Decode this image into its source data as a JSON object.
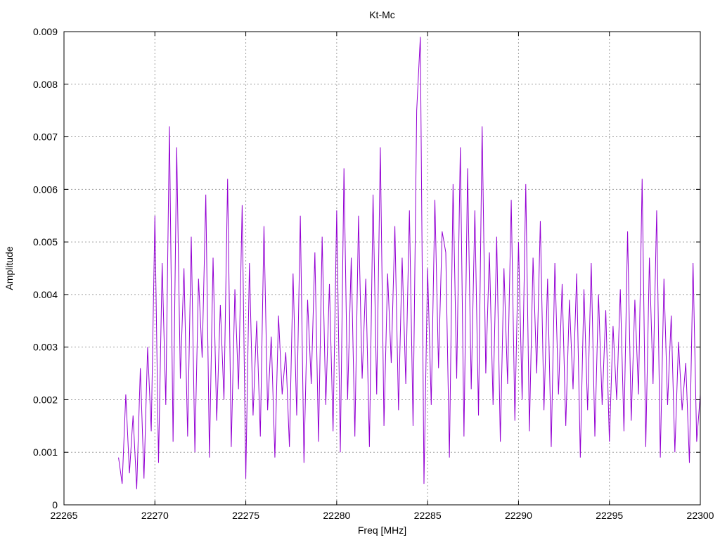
{
  "chart_data": {
    "type": "line",
    "title": "Kt-Mc",
    "xlabel": "Freq [MHz]",
    "ylabel": "Amplitude",
    "xlim": [
      22265,
      22300
    ],
    "ylim": [
      0,
      0.009
    ],
    "grid": true,
    "legend": "none",
    "line_color": "#9400d3",
    "x_ticks": [
      22265,
      22270,
      22275,
      22280,
      22285,
      22290,
      22295,
      22300
    ],
    "x_tick_labels": [
      "22265",
      "22270",
      "22275",
      "22280",
      "22285",
      "22290",
      "22295",
      "22300"
    ],
    "y_ticks": [
      0,
      0.001,
      0.002,
      0.003,
      0.004,
      0.005,
      0.006,
      0.007,
      0.008,
      0.009
    ],
    "y_tick_labels": [
      "0",
      "0.001",
      "0.002",
      "0.003",
      "0.004",
      "0.005",
      "0.006",
      "0.007",
      "0.008",
      "0.009"
    ],
    "series": [
      {
        "x": [
          22268.0,
          22268.2,
          22268.4,
          22268.6,
          22268.8,
          22269.0,
          22269.2,
          22269.4,
          22269.6,
          22269.8,
          22270.0,
          22270.2,
          22270.4,
          22270.6,
          22270.8,
          22271.0,
          22271.2,
          22271.4,
          22271.6,
          22271.8,
          22272.0,
          22272.2,
          22272.4,
          22272.6,
          22272.8,
          22273.0,
          22273.2,
          22273.4,
          22273.6,
          22273.8,
          22274.0,
          22274.2,
          22274.4,
          22274.6,
          22274.8,
          22275.0,
          22275.2,
          22275.4,
          22275.6,
          22275.8,
          22276.0,
          22276.2,
          22276.4,
          22276.6,
          22276.8,
          22277.0,
          22277.2,
          22277.4,
          22277.6,
          22277.8,
          22278.0,
          22278.2,
          22278.4,
          22278.6,
          22278.8,
          22279.0,
          22279.2,
          22279.4,
          22279.6,
          22279.8,
          22280.0,
          22280.2,
          22280.4,
          22280.6,
          22280.8,
          22281.0,
          22281.2,
          22281.4,
          22281.6,
          22281.8,
          22282.0,
          22282.2,
          22282.4,
          22282.6,
          22282.8,
          22283.0,
          22283.2,
          22283.4,
          22283.6,
          22283.8,
          22284.0,
          22284.2,
          22284.4,
          22284.6,
          22284.8,
          22285.0,
          22285.2,
          22285.4,
          22285.6,
          22285.8,
          22286.0,
          22286.2,
          22286.4,
          22286.6,
          22286.8,
          22287.0,
          22287.2,
          22287.4,
          22287.6,
          22287.8,
          22288.0,
          22288.2,
          22288.4,
          22288.6,
          22288.8,
          22289.0,
          22289.2,
          22289.4,
          22289.6,
          22289.8,
          22290.0,
          22290.2,
          22290.4,
          22290.6,
          22290.8,
          22291.0,
          22291.2,
          22291.4,
          22291.6,
          22291.8,
          22292.0,
          22292.2,
          22292.4,
          22292.6,
          22292.8,
          22293.0,
          22293.2,
          22293.4,
          22293.6,
          22293.8,
          22294.0,
          22294.2,
          22294.4,
          22294.6,
          22294.8,
          22295.0,
          22295.2,
          22295.4,
          22295.6,
          22295.8,
          22296.0,
          22296.2,
          22296.4,
          22296.6,
          22296.8,
          22297.0,
          22297.2,
          22297.4,
          22297.6,
          22297.8,
          22298.0,
          22298.2,
          22298.4,
          22298.6,
          22298.8,
          22299.0,
          22299.2,
          22299.4,
          22299.6,
          22299.8,
          22300.0
        ],
        "y": [
          0.0009,
          0.0004,
          0.0021,
          0.0006,
          0.0017,
          0.0003,
          0.0026,
          0.0005,
          0.003,
          0.0014,
          0.0055,
          0.0008,
          0.0046,
          0.0019,
          0.0072,
          0.0012,
          0.0068,
          0.0024,
          0.0045,
          0.0013,
          0.0051,
          0.001,
          0.0043,
          0.0028,
          0.0059,
          0.0009,
          0.0047,
          0.0016,
          0.0038,
          0.002,
          0.0062,
          0.0011,
          0.0041,
          0.0022,
          0.0057,
          0.0005,
          0.0046,
          0.0017,
          0.0035,
          0.0013,
          0.0053,
          0.0018,
          0.0032,
          0.0009,
          0.0036,
          0.0021,
          0.0029,
          0.0011,
          0.0044,
          0.0017,
          0.0055,
          0.0008,
          0.0039,
          0.0023,
          0.0048,
          0.0012,
          0.0051,
          0.0019,
          0.0042,
          0.0014,
          0.0056,
          0.001,
          0.0064,
          0.002,
          0.0047,
          0.0013,
          0.0055,
          0.0024,
          0.0043,
          0.0011,
          0.0059,
          0.0021,
          0.0068,
          0.0015,
          0.0044,
          0.0027,
          0.0053,
          0.0018,
          0.0047,
          0.0023,
          0.0056,
          0.0015,
          0.0075,
          0.0089,
          0.0004,
          0.0045,
          0.0019,
          0.0058,
          0.0026,
          0.0052,
          0.0048,
          0.0009,
          0.0061,
          0.0024,
          0.0068,
          0.0013,
          0.0064,
          0.0022,
          0.0056,
          0.0017,
          0.0072,
          0.0025,
          0.0048,
          0.0019,
          0.0051,
          0.0012,
          0.0045,
          0.0023,
          0.0058,
          0.0016,
          0.005,
          0.002,
          0.0061,
          0.0014,
          0.0047,
          0.0025,
          0.0054,
          0.0018,
          0.0043,
          0.0011,
          0.0046,
          0.0021,
          0.0042,
          0.0015,
          0.0039,
          0.0022,
          0.0044,
          0.0009,
          0.0041,
          0.0018,
          0.0046,
          0.0013,
          0.004,
          0.0019,
          0.0037,
          0.0012,
          0.0034,
          0.002,
          0.0041,
          0.0014,
          0.0052,
          0.0016,
          0.0039,
          0.0021,
          0.0062,
          0.0011,
          0.0047,
          0.0023,
          0.0056,
          0.0009,
          0.0043,
          0.0019,
          0.0036,
          0.001,
          0.0031,
          0.0018,
          0.0027,
          0.0008,
          0.0046,
          0.0012,
          0.0021
        ]
      }
    ]
  }
}
